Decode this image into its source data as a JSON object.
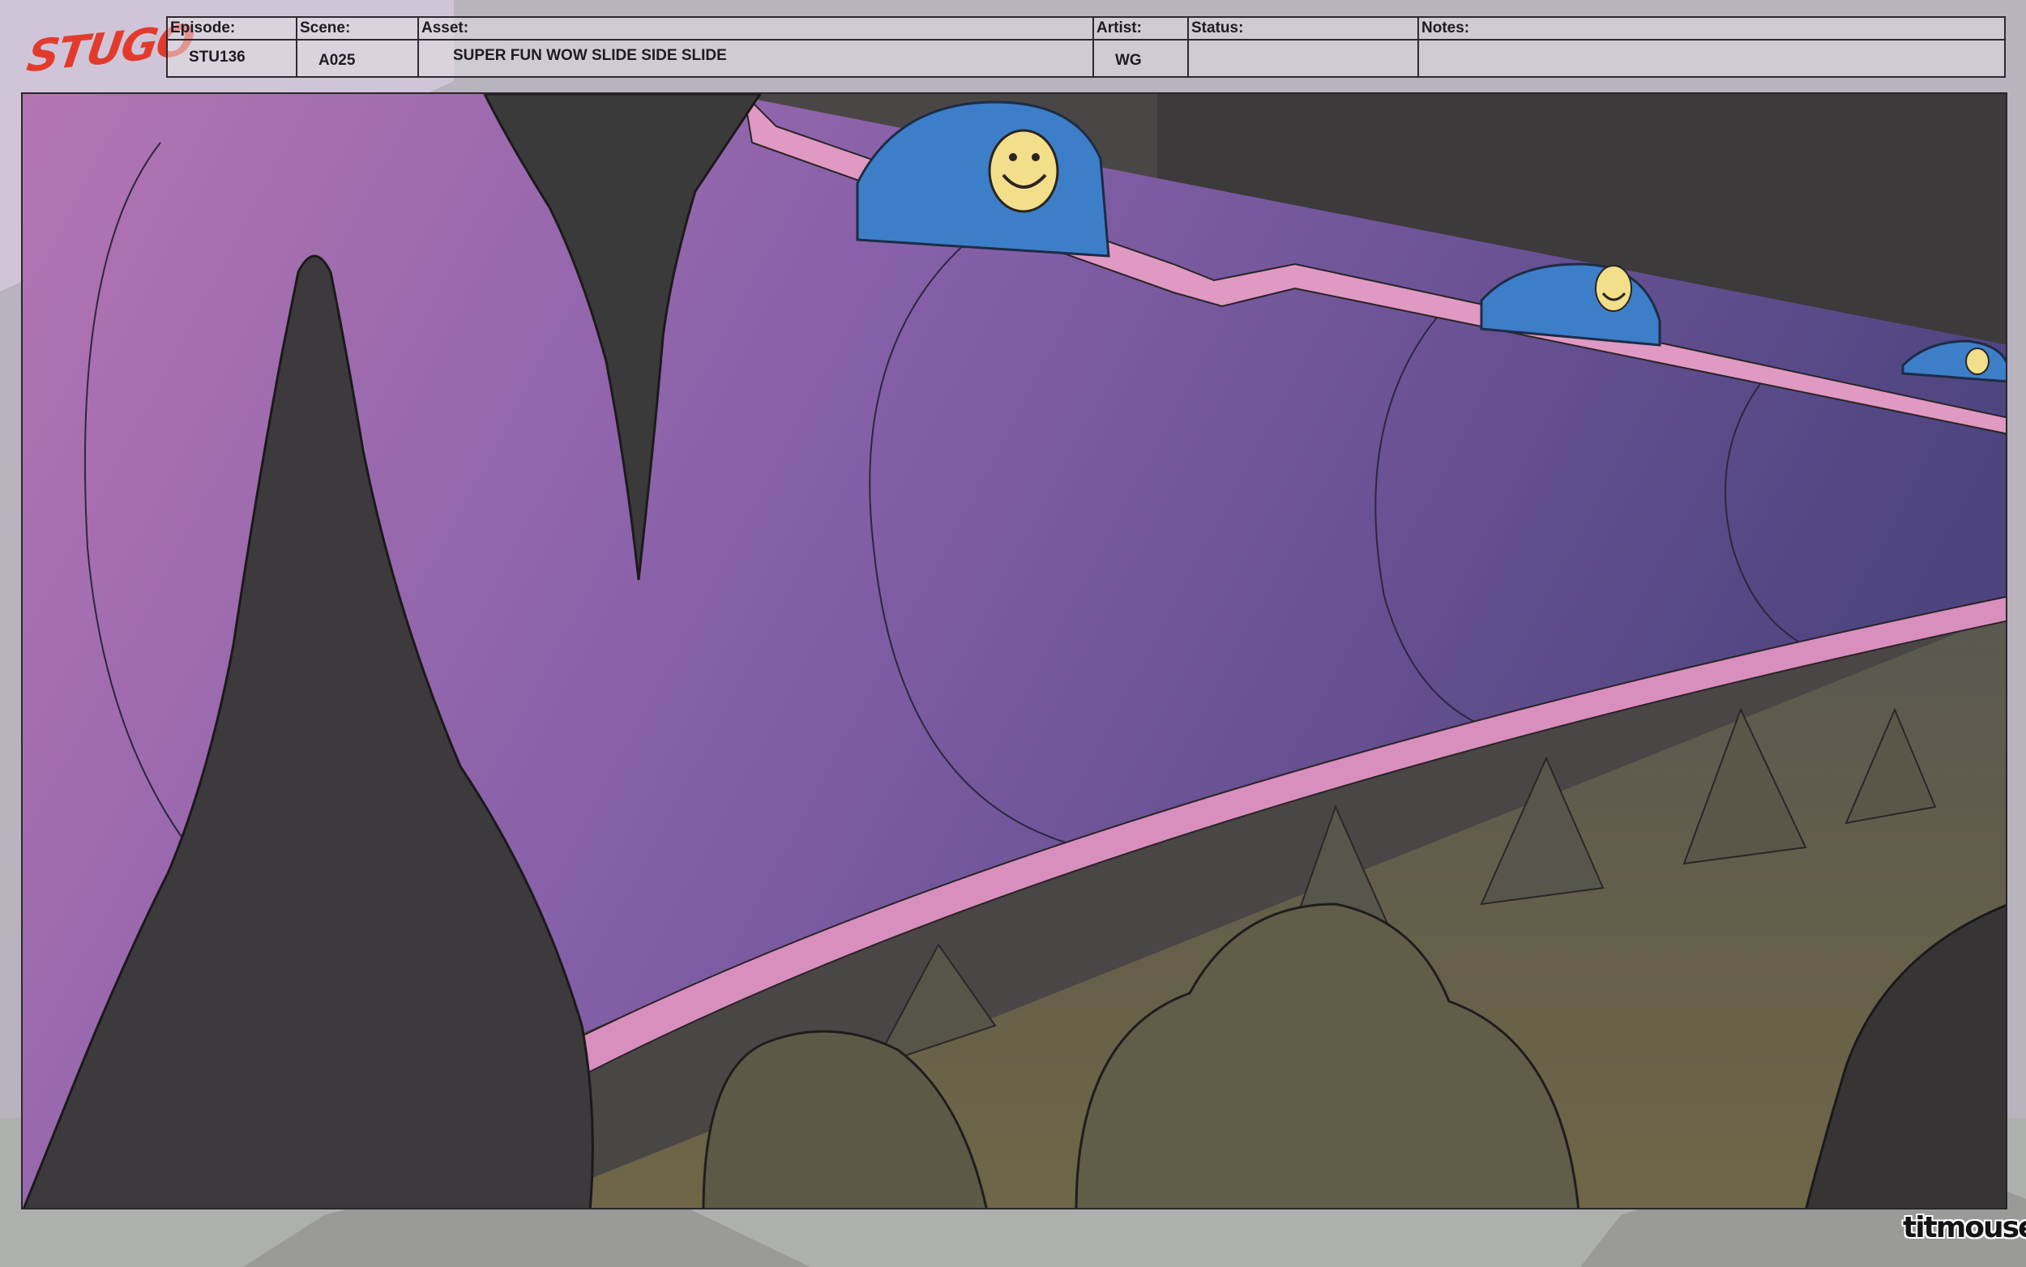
{
  "brand": {
    "show_logo": "STUGO",
    "studio_logo": "titmouse"
  },
  "slate": {
    "episode_label": "Episode:",
    "episode_value": "STU136",
    "scene_label": "Scene:",
    "scene_value": "A025",
    "asset_label": "Asset:",
    "asset_value": "SUPER FUN WOW SLIDE SIDE SLIDE",
    "artist_label": "Artist:",
    "artist_value": "WG",
    "status_label": "Status:",
    "status_value": "",
    "notes_label": "Notes:",
    "notes_value": ""
  },
  "colors": {
    "logo_red": "#e23b2e",
    "slide_purple": "#7a5aa6",
    "slide_pink": "#d58fbe",
    "slide_rim": "#e29ac0",
    "cave_dark": "#3d3a3c",
    "cave_floor": "#6b6244",
    "cart_blue": "#3d7ec9",
    "smiley_yellow": "#f3df8a"
  },
  "icons": [
    "smiley-face-icon"
  ]
}
